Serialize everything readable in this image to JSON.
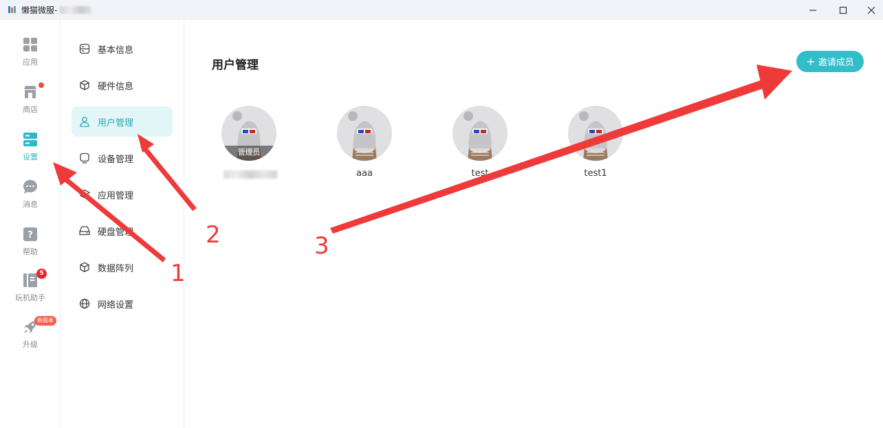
{
  "window": {
    "title": "懒猫微服-"
  },
  "rail": {
    "items": [
      {
        "label": "应用",
        "icon": "grid-icon"
      },
      {
        "label": "商店",
        "icon": "store-icon"
      },
      {
        "label": "设置",
        "icon": "settings-icon"
      },
      {
        "label": "消息",
        "icon": "chat-icon"
      },
      {
        "label": "帮助",
        "icon": "help-icon"
      },
      {
        "label": "玩机助手",
        "icon": "book-icon",
        "badge": "5"
      },
      {
        "label": "升级",
        "icon": "rocket-icon",
        "badge": "新版本"
      }
    ]
  },
  "submenu": {
    "items": [
      {
        "label": "基本信息",
        "icon": "server-icon"
      },
      {
        "label": "硬件信息",
        "icon": "cube-icon"
      },
      {
        "label": "用户管理",
        "icon": "user-icon"
      },
      {
        "label": "设备管理",
        "icon": "device-icon"
      },
      {
        "label": "应用管理",
        "icon": "layers-icon"
      },
      {
        "label": "硬盘管理",
        "icon": "disk-icon"
      },
      {
        "label": "数据阵列",
        "icon": "cube-icon"
      },
      {
        "label": "网络设置",
        "icon": "globe-icon"
      }
    ]
  },
  "main": {
    "title": "用户管理",
    "invite_label": "邀请成员",
    "members": [
      {
        "name": "",
        "role": "管理员"
      },
      {
        "name": "aaa"
      },
      {
        "name": "test"
      },
      {
        "name": "test1"
      }
    ]
  },
  "annotations": [
    "1",
    "2",
    "3"
  ],
  "colors": {
    "accent": "#30bfc9",
    "arrow": "#ef3a3a",
    "active_bg": "#e2f6f8"
  }
}
